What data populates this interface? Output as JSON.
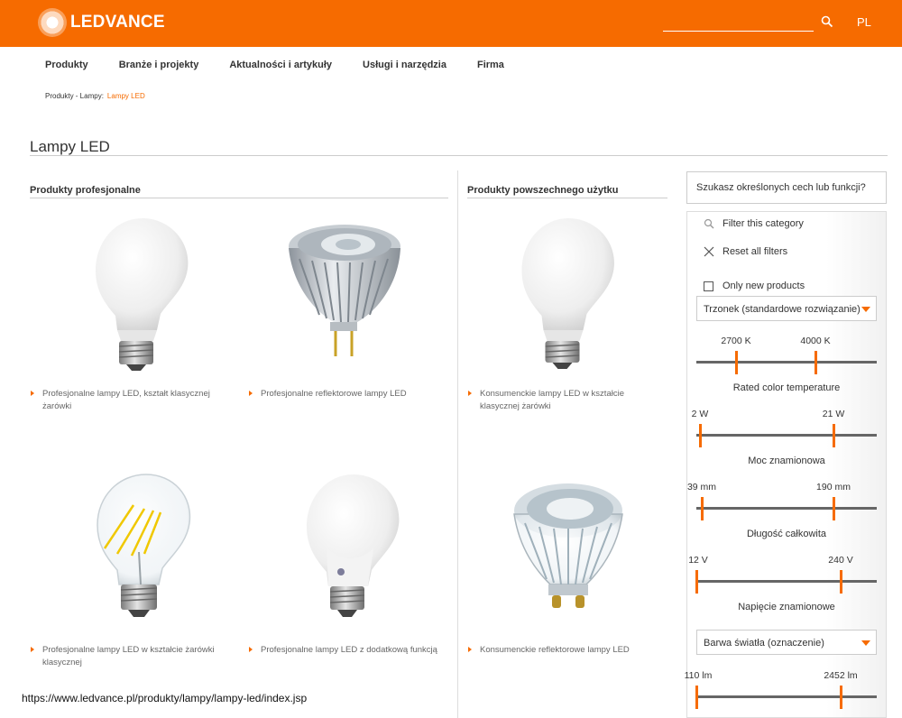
{
  "header": {
    "brand": "LEDVANCE",
    "lang": "PL",
    "colors": {
      "accent": "#f66b00",
      "header_bg": "#f66b00"
    },
    "icons": [
      "logo-icon",
      "search-icon"
    ]
  },
  "nav": {
    "items": [
      {
        "label": "Produkty"
      },
      {
        "label": "Branże i projekty"
      },
      {
        "label": "Aktualności i artykuły"
      },
      {
        "label": "Usługi i narzędzia"
      },
      {
        "label": "Firma"
      }
    ]
  },
  "breadcrumb": {
    "parent": "Produkty - Lampy:",
    "current": "Lampy LED"
  },
  "page": {
    "title": "Lampy LED"
  },
  "sections": {
    "professional": {
      "title": "Produkty profesjonalne",
      "products": [
        {
          "label": "Profesjonalne lampy LED, kształt klasycznej żarówki"
        },
        {
          "label": "Profesjonalne reflektorowe lampy LED"
        },
        {
          "label": "Profesjonalne lampy LED w kształcie żarówki klasycznej"
        },
        {
          "label": "Profesjonalne lampy LED z dodatkową funkcją"
        }
      ]
    },
    "consumer": {
      "title": "Produkty powszechnego użytku",
      "products": [
        {
          "label": "Konsumenckie lampy LED w kształcie klasycznej żarówki"
        },
        {
          "label": "Konsumenckie reflektorowe lampy LED"
        }
      ]
    }
  },
  "filters": {
    "question": "Szukasz określonych cech lub funkcji?",
    "filter_category": "Filter this category",
    "reset": "Reset all filters",
    "only_new": {
      "label": "Only new products",
      "checked": false
    },
    "select_base": "Trzonek (standardowe rozwiązanie)",
    "select_color": "Barwa światła (oznaczenie)",
    "ranges": [
      {
        "min_label": "2700 K",
        "max_label": "4000 K",
        "label": "Rated color temperature",
        "min_frac": 0.22,
        "max_frac": 0.66
      },
      {
        "min_label": "2 W",
        "max_label": "21 W",
        "label": "Moc znamionowa",
        "min_frac": 0.02,
        "max_frac": 0.76
      },
      {
        "min_label": "39 mm",
        "max_label": "190 mm",
        "label": "Długość całkowita",
        "min_frac": 0.03,
        "max_frac": 0.76
      },
      {
        "min_label": "12 V",
        "max_label": "240 V",
        "label": "Napięcie znamionowe",
        "min_frac": 0.0,
        "max_frac": 0.8
      },
      {
        "min_label": "110 lm",
        "max_label": "2452 lm",
        "label": "",
        "min_frac": 0.0,
        "max_frac": 0.8
      }
    ]
  },
  "footer": {
    "url": "https://www.ledvance.pl/produkty/lampy/lampy-led/index.jsp"
  }
}
